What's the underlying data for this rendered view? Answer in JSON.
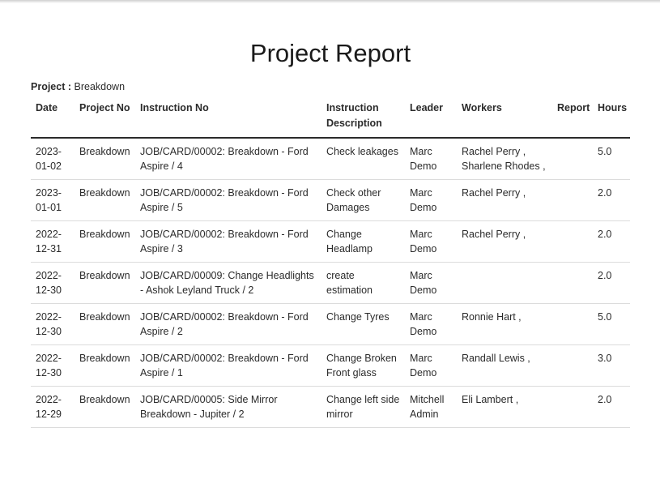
{
  "report": {
    "title": "Project Report",
    "project_label": "Project :",
    "project_value": "Breakdown"
  },
  "table": {
    "headers": {
      "date": "Date",
      "project_no": "Project No",
      "instruction_no": "Instruction No",
      "instruction_description": "Instruction Description",
      "leader": "Leader",
      "workers": "Workers",
      "report": "Report",
      "hours": "Hours"
    },
    "rows": [
      {
        "date": "2023-01-02",
        "project_no": "Breakdown",
        "instruction_no": "JOB/CARD/00002: Breakdown - Ford Aspire / 4",
        "instruction_description": "Check leakages",
        "leader": "Marc Demo",
        "workers": "Rachel Perry , Sharlene Rhodes ,",
        "report": "",
        "hours": "5.0"
      },
      {
        "date": "2023-01-01",
        "project_no": "Breakdown",
        "instruction_no": "JOB/CARD/00002: Breakdown - Ford Aspire / 5",
        "instruction_description": "Check other Damages",
        "leader": "Marc Demo",
        "workers": "Rachel Perry ,",
        "report": "",
        "hours": "2.0"
      },
      {
        "date": "2022-12-31",
        "project_no": "Breakdown",
        "instruction_no": "JOB/CARD/00002: Breakdown - Ford Aspire / 3",
        "instruction_description": "Change Headlamp",
        "leader": "Marc Demo",
        "workers": "Rachel Perry ,",
        "report": "",
        "hours": "2.0"
      },
      {
        "date": "2022-12-30",
        "project_no": "Breakdown",
        "instruction_no": "JOB/CARD/00009: Change Headlights - Ashok Leyland Truck / 2",
        "instruction_description": "create estimation",
        "leader": "Marc Demo",
        "workers": "",
        "report": "",
        "hours": "2.0"
      },
      {
        "date": "2022-12-30",
        "project_no": "Breakdown",
        "instruction_no": "JOB/CARD/00002: Breakdown - Ford Aspire / 2",
        "instruction_description": "Change Tyres",
        "leader": "Marc Demo",
        "workers": "Ronnie Hart ,",
        "report": "",
        "hours": "5.0"
      },
      {
        "date": "2022-12-30",
        "project_no": "Breakdown",
        "instruction_no": "JOB/CARD/00002: Breakdown - Ford Aspire / 1",
        "instruction_description": "Change Broken Front glass",
        "leader": "Marc Demo",
        "workers": "Randall Lewis ,",
        "report": "",
        "hours": "3.0"
      },
      {
        "date": "2022-12-29",
        "project_no": "Breakdown",
        "instruction_no": "JOB/CARD/00005: Side Mirror Breakdown - Jupiter / 2",
        "instruction_description": "Change left side mirror",
        "leader": "Mitchell Admin",
        "workers": "Eli Lambert ,",
        "report": "",
        "hours": "2.0"
      }
    ]
  }
}
